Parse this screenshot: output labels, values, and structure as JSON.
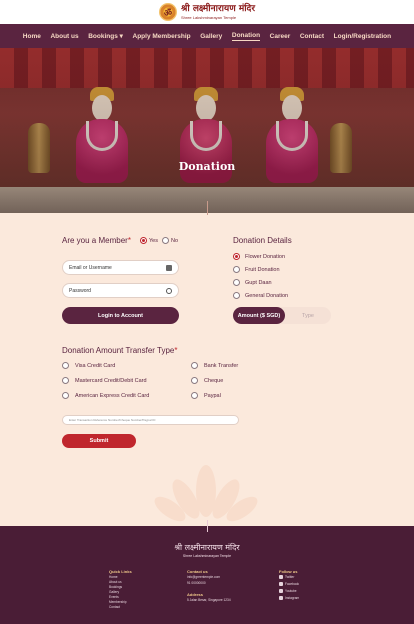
{
  "header": {
    "logo_hindi": "श्री लक्ष्मीनारायण मंदिर",
    "logo_english": "Shree Lakshminarayan Temple"
  },
  "nav": {
    "items": [
      "Home",
      "About us",
      "Bookings ▾",
      "Apply Membership",
      "Gallery",
      "Donation",
      "Career",
      "Contact",
      "Login/Registration"
    ],
    "active": "Donation"
  },
  "hero": {
    "title": "Donation"
  },
  "member": {
    "question": "Are you a Member",
    "yes": "Yes",
    "no": "No",
    "selected": "Yes",
    "email_placeholder": "Email or Username",
    "password_placeholder": "Password",
    "login_button": "Login to Account"
  },
  "donation_details": {
    "heading": "Donation Details",
    "options": [
      "Flower Donation",
      "Fruit Donation",
      "Gupt Daan",
      "General Donation"
    ],
    "selected": "Flower Donation",
    "amount_tab": "Amount ($ SGD)",
    "type_tab": "Type"
  },
  "transfer": {
    "heading": "Donation Amount Transfer Type",
    "left_options": [
      "Visa Credit Card",
      "Mastercard Credit/Debit Card",
      "American Express Credit Card"
    ],
    "right_options": [
      "Bank Transfer",
      "Cheque",
      "Paypal"
    ],
    "note_placeholder": "Enter Transaction Reference Number/Cheque Number/Paypal ID",
    "submit": "Submit"
  },
  "footer": {
    "logo_hindi": "श्री लक्ष्मीनारायण मंदिर",
    "logo_english": "Shree Lakshminarayan Temple",
    "quick_links_heading": "Quick Links",
    "quick_links": [
      "Home",
      "About us",
      "Bookings",
      "Gallery",
      "Events",
      "Membership",
      "Contact"
    ],
    "contact_heading": "Contact us",
    "contact_email": "info@greentemple.com",
    "contact_phone": "91 00000000",
    "address_heading": "Address",
    "address": "5 Jalan Besar, Singapore 1234",
    "follow_heading": "Follow us",
    "follow": [
      "Twitter",
      "Facebook",
      "Youtube",
      "Instagram"
    ]
  },
  "colors": {
    "primary": "#5a2440",
    "accent": "#c0262d",
    "background": "#fbe9dc"
  }
}
